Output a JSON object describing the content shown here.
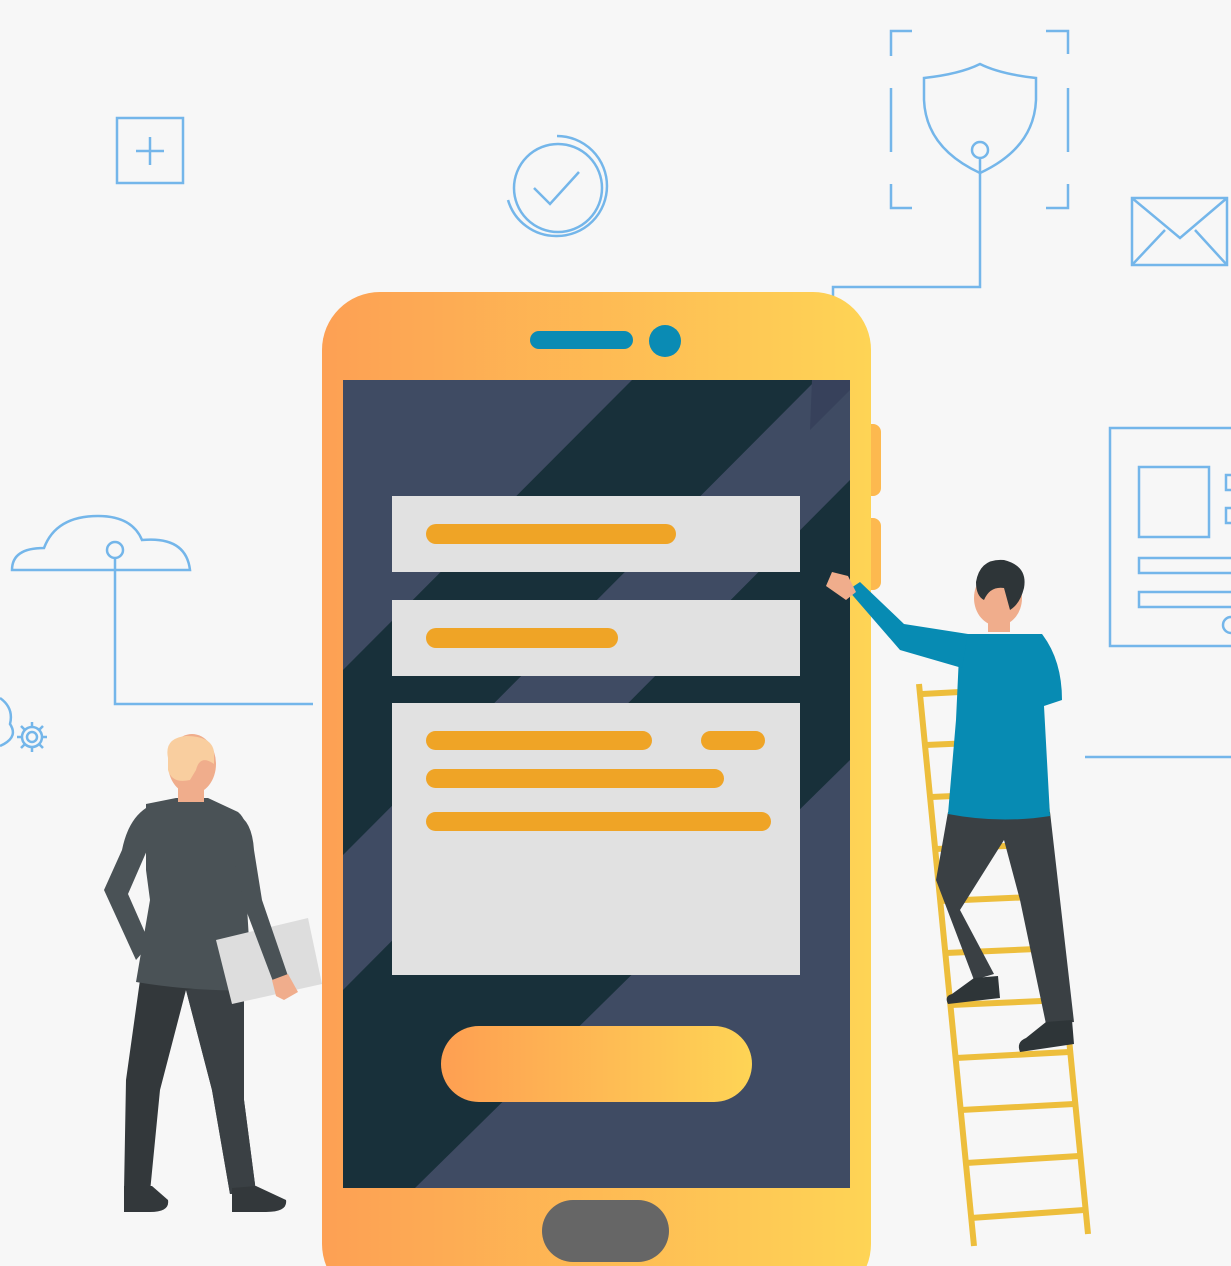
{
  "scene": {
    "description_text": "",
    "colors": {
      "background": "#f7f7f7",
      "line_art": "#6fb3e6",
      "phone_gradient_start": "#fda054",
      "phone_gradient_end": "#fed455",
      "screen_dark": "#19303a",
      "screen_stripe": "#3d4963",
      "field_bg": "#e1e1e1",
      "text_placeholder": "#efa426",
      "speaker": "#0a8bb4",
      "home_button": "#666666",
      "ladder": "#edbe3c",
      "man_right_shirt": "#078bb3",
      "man_right_pants": "#3a4044",
      "man_left_jacket": "#4a5256",
      "man_left_pants": "#33383b",
      "skin": "#f0ad8c",
      "hair_dark": "#2e3538",
      "hair_light": "#f9ce9f",
      "folder": "#dddddd"
    },
    "icons": [
      "plus-square-icon",
      "checkmark-circle-icon",
      "shield-icon",
      "envelope-icon",
      "cloud-icon",
      "gear-icon",
      "document-icon"
    ],
    "form": {
      "fields": [
        {
          "placeholder_lines": 1
        },
        {
          "placeholder_lines": 1
        },
        {
          "placeholder_lines": 3
        }
      ],
      "submit_button_text": ""
    }
  }
}
